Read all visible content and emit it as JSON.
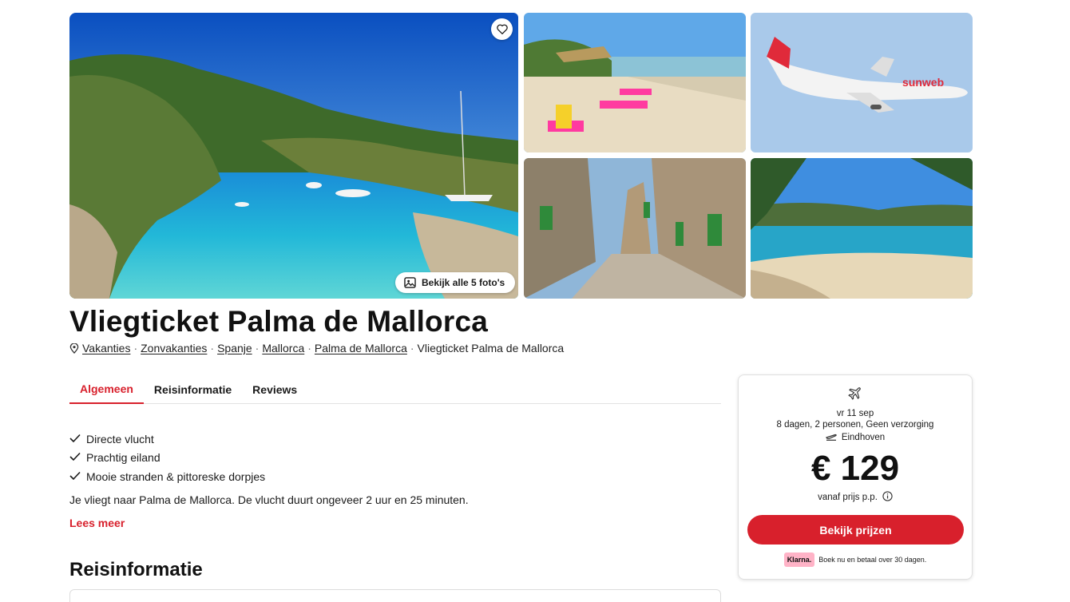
{
  "gallery": {
    "photos_button_label": "Bekijk alle 5 foto's"
  },
  "page_title": "Vliegticket Palma de Mallorca",
  "breadcrumb": {
    "items": [
      "Vakanties",
      "Zonvakanties",
      "Spanje",
      "Mallorca",
      "Palma de Mallorca"
    ],
    "current": "Vliegticket Palma de Mallorca",
    "separator": "·"
  },
  "tabs": [
    {
      "label": "Algemeen",
      "active": true
    },
    {
      "label": "Reisinformatie",
      "active": false
    },
    {
      "label": "Reviews",
      "active": false
    }
  ],
  "usps": [
    "Directe vlucht",
    "Prachtig eiland",
    "Mooie stranden & pittoreske dorpjes"
  ],
  "description": "Je vliegt naar Palma de Mallorca. De vlucht duurt ongeveer 2 uur en 25 minuten.",
  "read_more_label": "Lees meer",
  "section_heading": "Reisinformatie",
  "price_card": {
    "date": "vr 11 sep",
    "meta": "8 dagen, 2 personen, Geen verzorging",
    "departure": "Eindhoven",
    "price": "€ 129",
    "price_note": "vanaf prijs p.p.",
    "cta_label": "Bekijk prijzen",
    "klarna_badge": "Klarna.",
    "klarna_text": "Boek nu en betaal over 30 dagen."
  },
  "colors": {
    "accent": "#d8202c",
    "klarna_pink": "#ffb3c7"
  },
  "icons": [
    "heart-icon",
    "gallery-icon",
    "location-pin-icon",
    "check-icon",
    "plane-icon",
    "departure-icon",
    "info-icon"
  ]
}
